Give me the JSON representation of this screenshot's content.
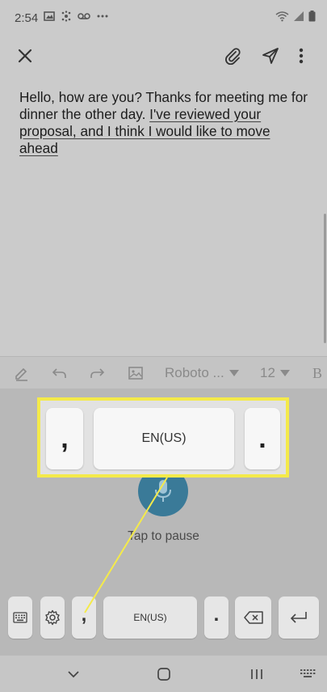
{
  "status_bar": {
    "time": "2:54",
    "left_icons": [
      "image-icon",
      "pinwheel-icon",
      "voicemail-icon",
      "more-notifications-icon"
    ],
    "right_icons": [
      "wifi-icon",
      "signal-icon",
      "battery-icon"
    ]
  },
  "toolbar": {
    "close_icon": "close-icon",
    "attach_icon": "paperclip-icon",
    "send_icon": "send-icon",
    "menu_icon": "more-vert-icon"
  },
  "editor": {
    "text_plain": "Hello, how are you? Thanks for meeting me for dinner the other day.",
    "text_underlined_1": "I've reviewed your",
    "text_underlined_2": "proposal, and I think I would like to move",
    "text_underlined_3": "ahead"
  },
  "format_bar": {
    "font_name": "Roboto ...",
    "font_size": "12",
    "bold_label": "B"
  },
  "voice_input": {
    "status_label": "Tap to pause"
  },
  "keyboard": {
    "comma_label": ",",
    "language_label": "EN(US)",
    "period_label": "."
  },
  "callout": {
    "comma_label": ",",
    "language_label": "EN(US)",
    "period_label": "."
  },
  "colors": {
    "highlight_border": "#f4ea4a",
    "mic_button": "#3a7a98"
  }
}
